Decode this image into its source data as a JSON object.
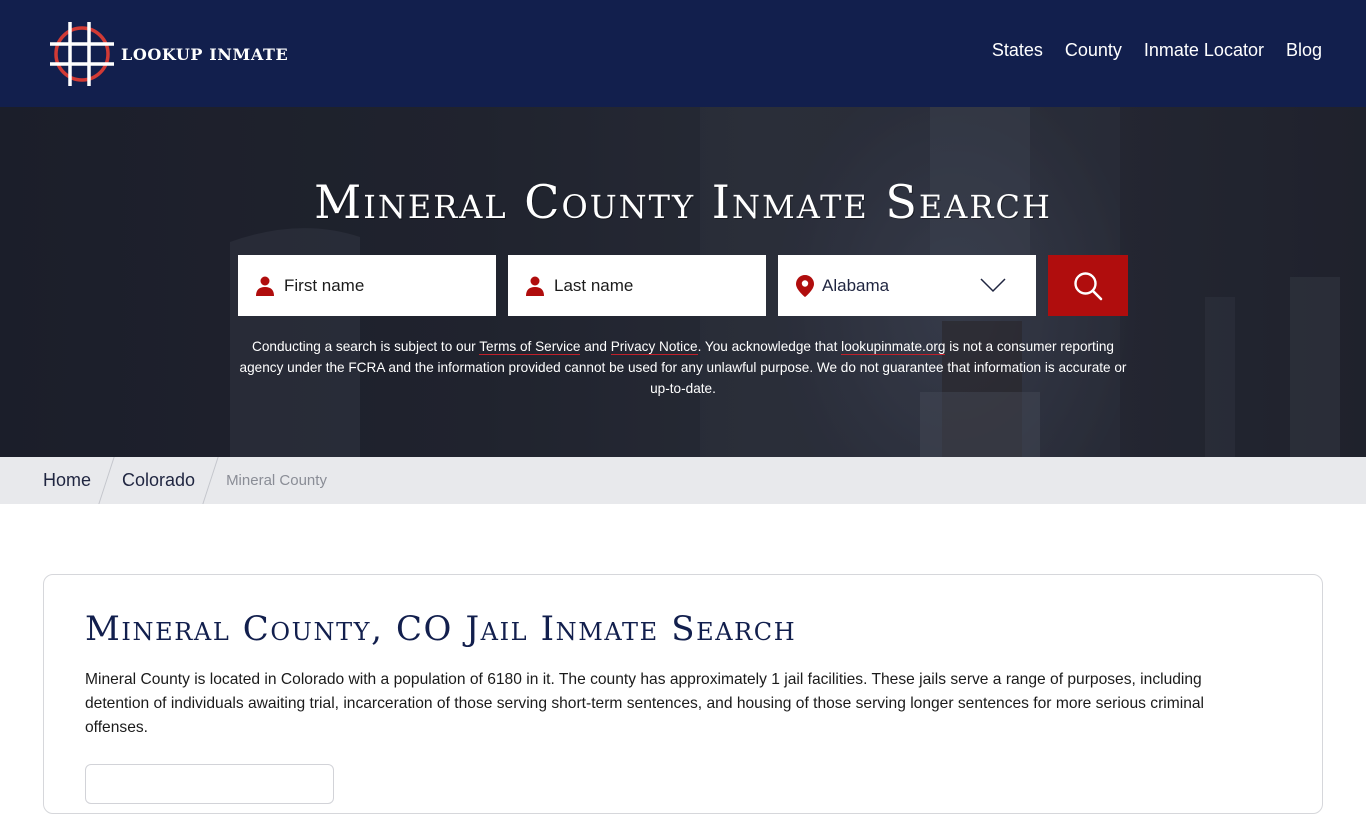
{
  "header": {
    "logo_text": "LOOKUP INMATE",
    "nav": [
      {
        "label": "States"
      },
      {
        "label": "County"
      },
      {
        "label": "Inmate Locator"
      },
      {
        "label": "Blog"
      }
    ]
  },
  "hero": {
    "title": "Mineral County Inmate Search",
    "first_name_placeholder": "First name",
    "last_name_placeholder": "Last name",
    "state_selected": "Alabama",
    "search_icon": "search-icon",
    "disclaimer": {
      "part1": "Conducting a search is subject to our ",
      "terms_link": "Terms of Service",
      "part2": " and ",
      "privacy_link": "Privacy Notice",
      "part3": ". You acknowledge that ",
      "site_link": "lookupinmate.org",
      "part4": " is not a consumer reporting agency under the FCRA and the information provided cannot be used for any unlawful purpose. We do not guarantee that information is accurate or up-to-date."
    }
  },
  "breadcrumb": {
    "items": [
      {
        "label": "Home"
      },
      {
        "label": "Colorado"
      },
      {
        "label": "Mineral County"
      }
    ]
  },
  "card": {
    "title": "Mineral County, CO Jail Inmate Search",
    "text": "Mineral County is located in Colorado with a population of 6180 in it. The county has approximately 1 jail facilities. These jails serve a range of purposes, including detention of individuals awaiting trial, incarceration of those serving short-term sentences, and housing of those serving longer sentences for more serious criminal offenses."
  },
  "colors": {
    "brand_navy": "#121f4d",
    "accent_red": "#b00d0d",
    "breadcrumb_bg": "#e8e9ec"
  }
}
